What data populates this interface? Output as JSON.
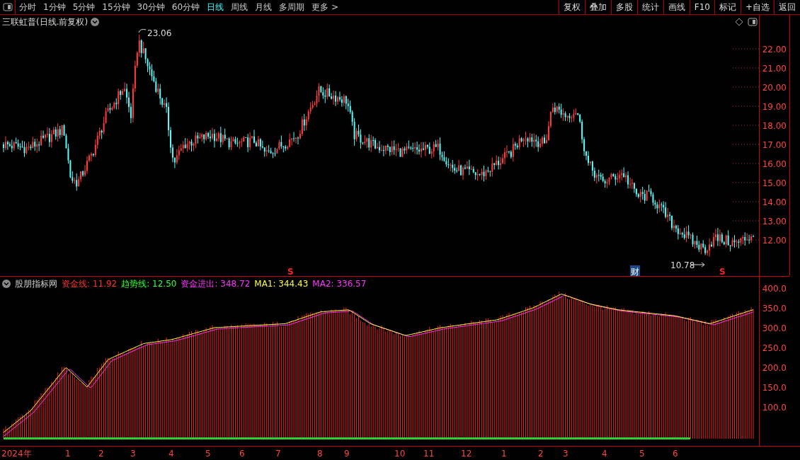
{
  "toolbar": {
    "periods": [
      {
        "label": "分时",
        "selected": false
      },
      {
        "label": "1分钟",
        "selected": false
      },
      {
        "label": "5分钟",
        "selected": false
      },
      {
        "label": "15分钟",
        "selected": false
      },
      {
        "label": "30分钟",
        "selected": false
      },
      {
        "label": "60分钟",
        "selected": false
      },
      {
        "label": "日线",
        "selected": true
      },
      {
        "label": "周线",
        "selected": false
      },
      {
        "label": "月线",
        "selected": false
      },
      {
        "label": "多周期",
        "selected": false
      },
      {
        "label": "更多 >",
        "selected": false
      }
    ],
    "buttons": [
      "复权",
      "叠加",
      "多股",
      "统计",
      "画线",
      "F10",
      "标记",
      "+自选",
      "返回"
    ]
  },
  "price_chart": {
    "title": "三联虹普(日线.前复权)",
    "high_label": "23.06",
    "low_label": "10.78",
    "markers": [
      {
        "kind": "signal",
        "text": "S"
      },
      {
        "kind": "finance",
        "text": "财"
      },
      {
        "kind": "signal",
        "text": "S"
      }
    ],
    "axis_ticks": [
      "22.00",
      "21.00",
      "20.00",
      "19.00",
      "18.00",
      "17.00",
      "16.00",
      "15.00",
      "14.00",
      "13.00",
      "12.00"
    ]
  },
  "indicator": {
    "name": "股朋指标网",
    "values": [
      {
        "label": "资金线:",
        "value": "11.92",
        "color": "#ff3232"
      },
      {
        "label": "趋势线:",
        "value": "12.50",
        "color": "#32ff32"
      },
      {
        "label": "资金进出:",
        "value": "348.72",
        "color": "#ff32ff"
      },
      {
        "label": "MA1:",
        "value": "344.43",
        "color": "#ffff32"
      },
      {
        "label": "MA2:",
        "value": "336.57",
        "color": "#ff32ff"
      }
    ],
    "axis_ticks": [
      "400.0",
      "350.0",
      "300.0",
      "250.0",
      "200.0",
      "150.0",
      "100.0"
    ]
  },
  "date_axis": [
    "2024年",
    "1",
    "2",
    "3",
    "4",
    "5",
    "6",
    "7",
    "8",
    "9",
    "10",
    "11",
    "12",
    "1",
    "2",
    "3",
    "4",
    "5",
    "6"
  ]
}
